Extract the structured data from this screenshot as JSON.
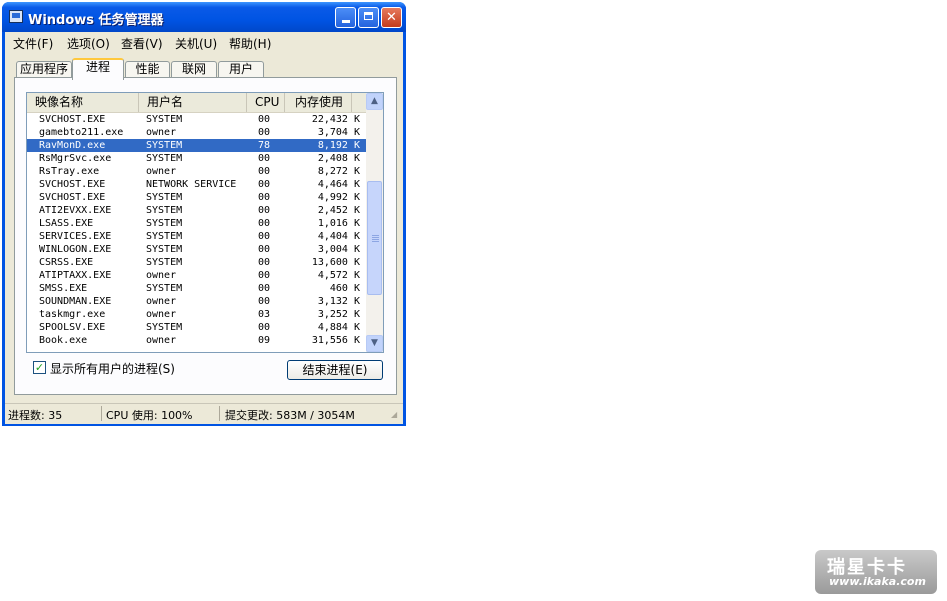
{
  "window": {
    "title": "Windows 任务管理器"
  },
  "menu": [
    {
      "label": "文件(F)"
    },
    {
      "label": "选项(O)"
    },
    {
      "label": "查看(V)"
    },
    {
      "label": "关机(U)"
    },
    {
      "label": "帮助(H)"
    }
  ],
  "tabs": [
    {
      "label": "应用程序",
      "active": false
    },
    {
      "label": "进程",
      "active": true
    },
    {
      "label": "性能",
      "active": false
    },
    {
      "label": "联网",
      "active": false
    },
    {
      "label": "用户",
      "active": false
    }
  ],
  "columns": {
    "name": "映像名称",
    "user": "用户名",
    "cpu": "CPU",
    "mem": "内存使用"
  },
  "processes": [
    {
      "name": "SVCHOST.EXE",
      "user": "SYSTEM",
      "cpu": "00",
      "mem": "22,432 K"
    },
    {
      "name": "gamebto211.exe",
      "user": "owner",
      "cpu": "00",
      "mem": "3,704 K"
    },
    {
      "name": "RavMonD.exe",
      "user": "SYSTEM",
      "cpu": "78",
      "mem": "8,192 K",
      "selected": true
    },
    {
      "name": "RsMgrSvc.exe",
      "user": "SYSTEM",
      "cpu": "00",
      "mem": "2,408 K"
    },
    {
      "name": "RsTray.exe",
      "user": "owner",
      "cpu": "00",
      "mem": "8,272 K"
    },
    {
      "name": "SVCHOST.EXE",
      "user": "NETWORK SERVICE",
      "cpu": "00",
      "mem": "4,464 K"
    },
    {
      "name": "SVCHOST.EXE",
      "user": "SYSTEM",
      "cpu": "00",
      "mem": "4,992 K"
    },
    {
      "name": "ATI2EVXX.EXE",
      "user": "SYSTEM",
      "cpu": "00",
      "mem": "2,452 K"
    },
    {
      "name": "LSASS.EXE",
      "user": "SYSTEM",
      "cpu": "00",
      "mem": "1,016 K"
    },
    {
      "name": "SERVICES.EXE",
      "user": "SYSTEM",
      "cpu": "00",
      "mem": "4,404 K"
    },
    {
      "name": "WINLOGON.EXE",
      "user": "SYSTEM",
      "cpu": "00",
      "mem": "3,004 K"
    },
    {
      "name": "CSRSS.EXE",
      "user": "SYSTEM",
      "cpu": "00",
      "mem": "13,600 K"
    },
    {
      "name": "ATIPTAXX.EXE",
      "user": "owner",
      "cpu": "00",
      "mem": "4,572 K"
    },
    {
      "name": "SMSS.EXE",
      "user": "SYSTEM",
      "cpu": "00",
      "mem": "460 K"
    },
    {
      "name": "SOUNDMAN.EXE",
      "user": "owner",
      "cpu": "00",
      "mem": "3,132 K"
    },
    {
      "name": "taskmgr.exe",
      "user": "owner",
      "cpu": "03",
      "mem": "3,252 K"
    },
    {
      "name": "SPOOLSV.EXE",
      "user": "SYSTEM",
      "cpu": "00",
      "mem": "4,884 K"
    },
    {
      "name": "Book.exe",
      "user": "owner",
      "cpu": "09",
      "mem": "31,556 K"
    }
  ],
  "show_all_users": {
    "label": "显示所有用户的进程(S)",
    "checked": true
  },
  "end_process_label": "结束进程(E)",
  "status": {
    "processes": "进程数: 35",
    "cpu": "CPU 使用: 100%",
    "commit": "提交更改: 583M / 3054M"
  },
  "watermark": {
    "brand": "瑞星卡卡",
    "url": "www.ikaka.com"
  },
  "colors": {
    "title_bar": "#0054e3",
    "selection": "#316ac5",
    "active_tab_accent": "#ffc83c",
    "close_button": "#c43b1b"
  }
}
